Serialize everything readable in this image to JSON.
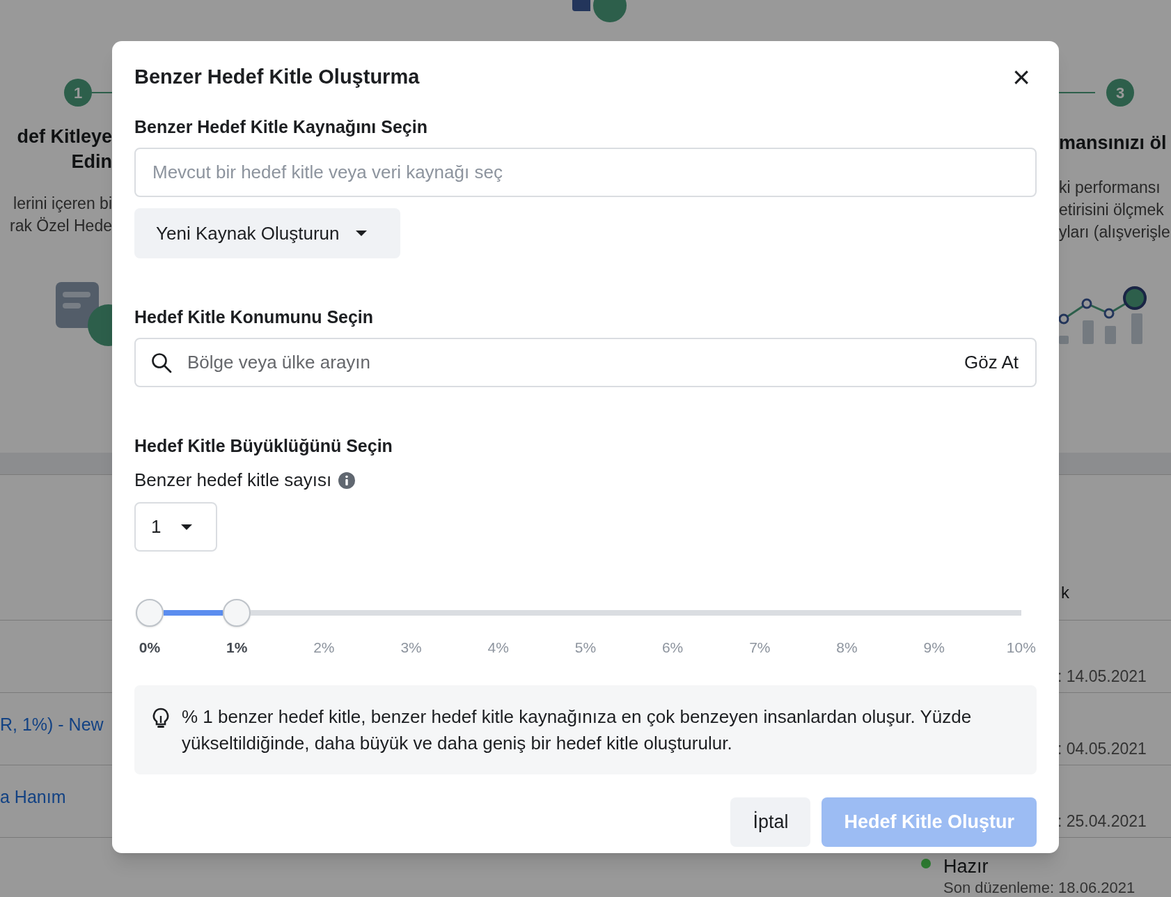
{
  "background": {
    "steps": [
      {
        "number": "1",
        "title_lines": [
          "def Kitleye",
          "Edin"
        ],
        "text_lines": [
          "lerini içeren bi",
          "rak Özel Hede"
        ]
      },
      {
        "number": "3",
        "title_lines": [
          "mansınızı öl"
        ],
        "text_lines": [
          "ki performansı",
          "etirisini ölçmek",
          "yları (alışverişle"
        ]
      }
    ],
    "left_rows": [
      "R, 1%) - New",
      "a Hanım"
    ],
    "right_column_fragment": "k",
    "right_rows": [
      ": 14.05.2021",
      ": 04.05.2021",
      ": 25.04.2021"
    ],
    "status": {
      "label": "Hazır",
      "color": "#2e7d32",
      "edited": "Son düzenleme: 18.06.2021"
    }
  },
  "dialog": {
    "title": "Benzer Hedef Kitle Oluşturma",
    "close": "×",
    "source": {
      "label": "Benzer Hedef Kitle Kaynağını Seçin",
      "placeholder": "Mevcut bir hedef kitle veya veri kaynağı seç",
      "new_source_button": "Yeni Kaynak Oluşturun"
    },
    "location": {
      "label": "Hedef Kitle Konumunu Seçin",
      "placeholder": "Bölge veya ülke arayın",
      "browse": "Göz At"
    },
    "size": {
      "label": "Hedef Kitle Büyüklüğünü Seçin",
      "count_label": "Benzer hedef kitle sayısı",
      "count_value": "1",
      "slider": {
        "level": 0.1,
        "ticks": [
          {
            "label": "0%",
            "selected": true
          },
          {
            "label": "1%",
            "selected": true
          },
          {
            "label": "2%",
            "selected": false
          },
          {
            "label": "3%",
            "selected": false
          },
          {
            "label": "4%",
            "selected": false
          },
          {
            "label": "5%",
            "selected": false
          },
          {
            "label": "6%",
            "selected": false
          },
          {
            "label": "7%",
            "selected": false
          },
          {
            "label": "8%",
            "selected": false
          },
          {
            "label": "9%",
            "selected": false
          },
          {
            "label": "10%",
            "selected": false
          }
        ]
      }
    },
    "tip": "% 1 benzer hedef kitle, benzer hedef kitle kaynağınıza en çok benzeyen insanlardan oluşur. Yüzde yükseltildiğinde, daha büyük ve daha geniş bir hedef kitle oluşturulur.",
    "buttons": [
      {
        "label": "İptal",
        "kind": "secondary",
        "disabled": false
      },
      {
        "label": "Hedef Kitle Oluştur",
        "kind": "primary",
        "disabled": true
      }
    ]
  }
}
